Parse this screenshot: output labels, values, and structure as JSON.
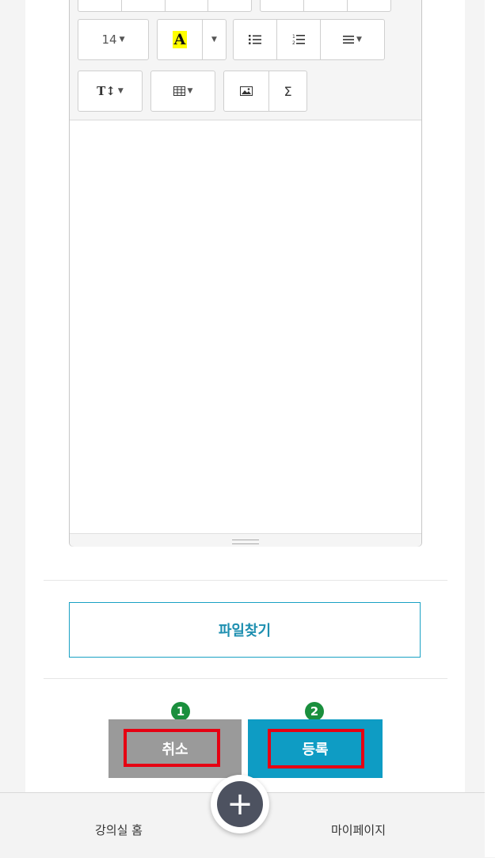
{
  "toolbar": {
    "font_size": "14",
    "font_color_label": "A",
    "text_style_label": "T↕",
    "sigma_label": "Σ"
  },
  "file_button_label": "파일찾기",
  "badges": [
    "1",
    "2"
  ],
  "actions": {
    "cancel_label": "취소",
    "submit_label": "등록"
  },
  "bottom_nav": {
    "home_label": "강의실 홈",
    "mypage_label": "마이페이지",
    "add_label": "+"
  },
  "colors": {
    "accent": "#0e9cc4",
    "cancel": "#9a9a9a",
    "highlight": "#e60012",
    "badge": "#1a8f3d"
  },
  "icons": [
    "caret-down-icon",
    "bullet-list-icon",
    "numbered-list-icon",
    "align-icon",
    "table-icon",
    "image-icon",
    "plus-icon"
  ]
}
